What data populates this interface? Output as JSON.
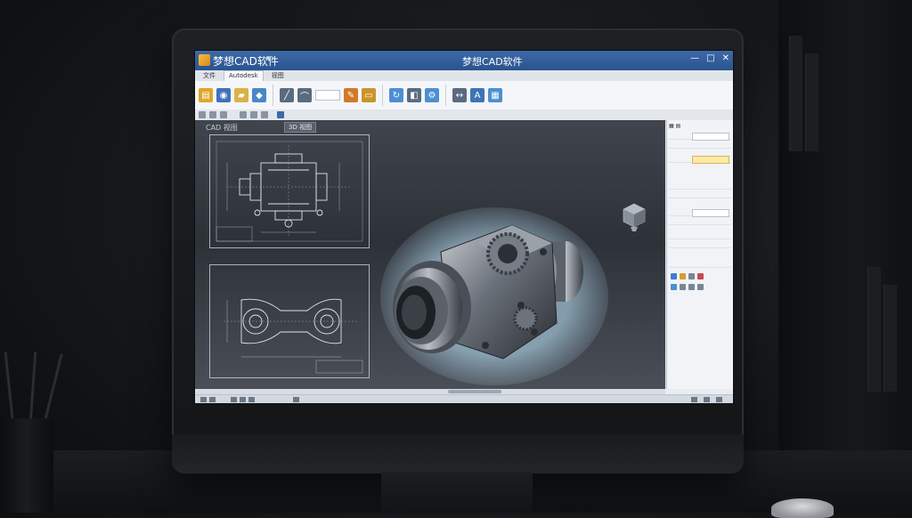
{
  "app": {
    "name": "梦想CAD软件",
    "window_title": "梦想CAD软件",
    "quick_access_glyph": "▾"
  },
  "window_controls": {
    "minimize": "—",
    "maximize": "□",
    "close": "✕"
  },
  "ribbon_tabs": [
    {
      "label": "文件",
      "active": false
    },
    {
      "label": "Autodesk",
      "active": true
    },
    {
      "label": "视图",
      "active": false
    }
  ],
  "workspace": {
    "view_label": "CAD 视图",
    "view_tab": "3D 视图"
  },
  "ribbon_icons": [
    {
      "name": "open-icon",
      "color": "#e0a52a",
      "glyph": "▤"
    },
    {
      "name": "save-icon",
      "color": "#3f73b7",
      "glyph": "◉"
    },
    {
      "name": "folder-icon",
      "color": "#d9b34a",
      "glyph": "▰"
    },
    {
      "name": "cube-icon",
      "color": "#4a86c8",
      "glyph": "◆"
    },
    {
      "name": "line-tool-icon",
      "color": "#5a6a80",
      "glyph": "╱"
    },
    {
      "name": "arc-tool-icon",
      "color": "#5a6a80",
      "glyph": "⌒"
    },
    {
      "name": "pencil-icon",
      "color": "#d07a2a",
      "glyph": "✎"
    },
    {
      "name": "measure-icon",
      "color": "#c9962a",
      "glyph": "▭"
    },
    {
      "name": "rotate-icon",
      "color": "#4c8fd1",
      "glyph": "↻"
    },
    {
      "name": "mirror-icon",
      "color": "#5a6a80",
      "glyph": "◧"
    },
    {
      "name": "settings-icon",
      "color": "#4c8fd1",
      "glyph": "⚙"
    },
    {
      "name": "dimension-icon",
      "color": "#5a6a80",
      "glyph": "↔"
    },
    {
      "name": "text-tool-icon",
      "color": "#3f73b7",
      "glyph": "A"
    },
    {
      "name": "layers-icon",
      "color": "#4c8fd1",
      "glyph": "▦"
    }
  ],
  "colors": {
    "titlebar": "#2a548f",
    "accent_highlight": "#fde9a8"
  }
}
